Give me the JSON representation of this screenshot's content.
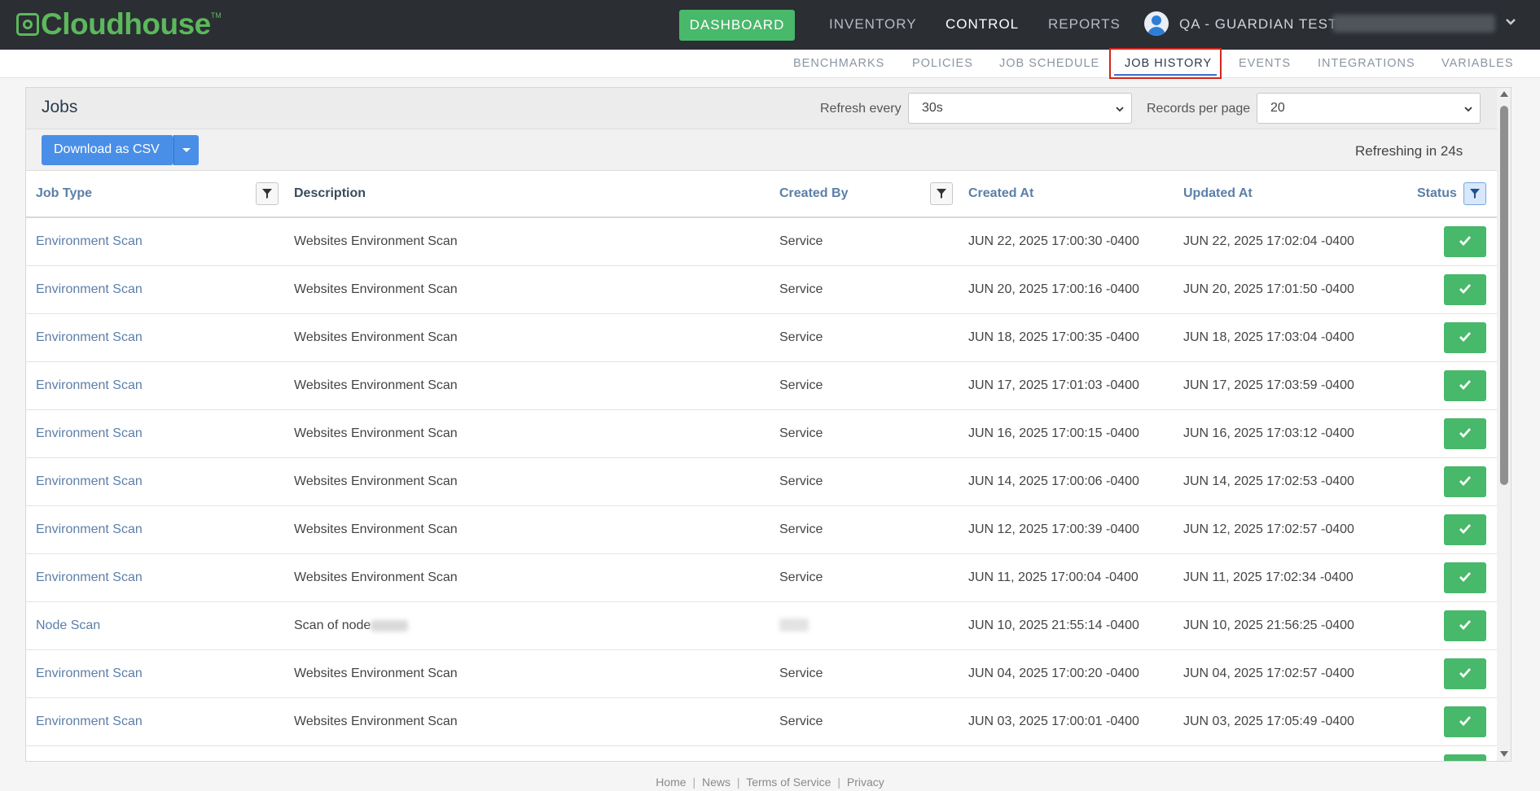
{
  "app": {
    "logo": "Cloudhouse",
    "logo_tm": "TM"
  },
  "topnav": {
    "dashboard": "DASHBOARD",
    "inventory": "INVENTORY",
    "control": "CONTROL",
    "reports": "REPORTS",
    "user": "QA - GUARDIAN TEST"
  },
  "subnav": {
    "benchmarks": "BENCHMARKS",
    "policies": "POLICIES",
    "job_schedule": "JOB SCHEDULE",
    "job_history": "JOB HISTORY",
    "events": "EVENTS",
    "integrations": "INTEGRATIONS",
    "variables": "VARIABLES"
  },
  "panel": {
    "title": "Jobs",
    "refresh_label": "Refresh every",
    "refresh_value": "30s",
    "records_label": "Records per page",
    "records_value": "20",
    "download_label": "Download as CSV",
    "refreshing": "Refreshing in 24s"
  },
  "table": {
    "headers": {
      "job_type": "Job Type",
      "description": "Description",
      "created_by": "Created By",
      "created_at": "Created At",
      "updated_at": "Updated At",
      "status": "Status"
    },
    "rows": [
      {
        "job_type": "Environment Scan",
        "description": "Websites Environment Scan",
        "created_by": "Service",
        "created_at": "JUN 22, 2025 17:00:30 -0400",
        "updated_at": "JUN 22, 2025 17:02:04 -0400"
      },
      {
        "job_type": "Environment Scan",
        "description": "Websites Environment Scan",
        "created_by": "Service",
        "created_at": "JUN 20, 2025 17:00:16 -0400",
        "updated_at": "JUN 20, 2025 17:01:50 -0400"
      },
      {
        "job_type": "Environment Scan",
        "description": "Websites Environment Scan",
        "created_by": "Service",
        "created_at": "JUN 18, 2025 17:00:35 -0400",
        "updated_at": "JUN 18, 2025 17:03:04 -0400"
      },
      {
        "job_type": "Environment Scan",
        "description": "Websites Environment Scan",
        "created_by": "Service",
        "created_at": "JUN 17, 2025 17:01:03 -0400",
        "updated_at": "JUN 17, 2025 17:03:59 -0400"
      },
      {
        "job_type": "Environment Scan",
        "description": "Websites Environment Scan",
        "created_by": "Service",
        "created_at": "JUN 16, 2025 17:00:15 -0400",
        "updated_at": "JUN 16, 2025 17:03:12 -0400"
      },
      {
        "job_type": "Environment Scan",
        "description": "Websites Environment Scan",
        "created_by": "Service",
        "created_at": "JUN 14, 2025 17:00:06 -0400",
        "updated_at": "JUN 14, 2025 17:02:53 -0400"
      },
      {
        "job_type": "Environment Scan",
        "description": "Websites Environment Scan",
        "created_by": "Service",
        "created_at": "JUN 12, 2025 17:00:39 -0400",
        "updated_at": "JUN 12, 2025 17:02:57 -0400"
      },
      {
        "job_type": "Environment Scan",
        "description": "Websites Environment Scan",
        "created_by": "Service",
        "created_at": "JUN 11, 2025 17:00:04 -0400",
        "updated_at": "JUN 11, 2025 17:02:34 -0400"
      },
      {
        "job_type": "Node Scan",
        "description": "Scan of node",
        "created_by": "",
        "created_at": "JUN 10, 2025 21:55:14 -0400",
        "updated_at": "JUN 10, 2025 21:56:25 -0400"
      },
      {
        "job_type": "Environment Scan",
        "description": "Websites Environment Scan",
        "created_by": "Service",
        "created_at": "JUN 04, 2025 17:00:20 -0400",
        "updated_at": "JUN 04, 2025 17:02:57 -0400"
      },
      {
        "job_type": "Environment Scan",
        "description": "Websites Environment Scan",
        "created_by": "Service",
        "created_at": "JUN 03, 2025 17:00:01 -0400",
        "updated_at": "JUN 03, 2025 17:05:49 -0400"
      }
    ]
  },
  "footer": {
    "home": "Home",
    "news": "News",
    "terms": "Terms of Service",
    "privacy": "Privacy",
    "separator": "|"
  },
  "colors": {
    "accent_green": "#48b86a",
    "accent_blue": "#4a8fe7",
    "nav_bg": "#2b2e33",
    "highlight_red": "#d0261e"
  }
}
